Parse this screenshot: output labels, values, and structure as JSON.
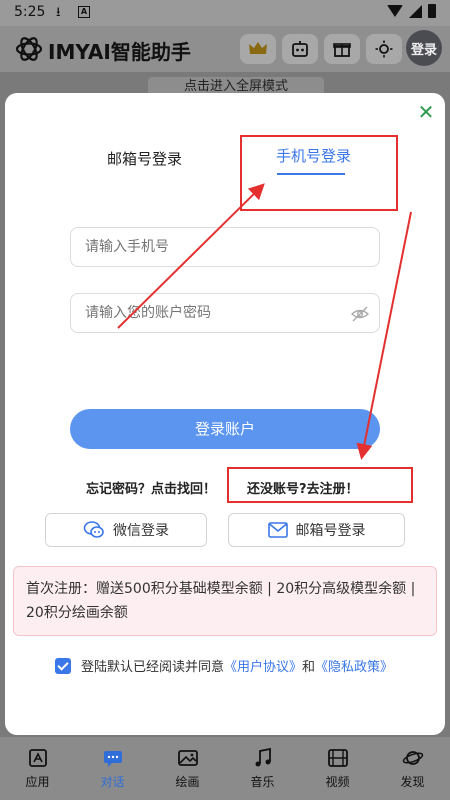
{
  "status_bar": {
    "time": "5:25",
    "download_icon": "download-icon",
    "a_badge": "A"
  },
  "header": {
    "title": "IMYAI智能助手",
    "login_label": "登录",
    "icons": [
      "crown-icon",
      "robot-icon",
      "gift-icon",
      "sun-icon"
    ]
  },
  "fullscreen_tip": "点击进入全屏模式",
  "modal": {
    "tabs": {
      "email": "邮箱号登录",
      "phone": "手机号登录",
      "active": "phone"
    },
    "phone_placeholder": "请输入手机号",
    "password_placeholder": "请输入您的账户密码",
    "login_button": "登录账户",
    "forgot": "忘记密码？点击找回！",
    "register": "还没账号?去注册！",
    "wechat_login": "微信登录",
    "email_login": "邮箱号登录",
    "notice": "首次注册：赠送500积分基础模型余额 | 20积分高级模型余额 | 20积分绘画余额",
    "agree_prefix": "登陆默认已经阅读并同意",
    "user_agreement": "《用户协议》",
    "and": "和",
    "privacy_policy": "《隐私政策》",
    "agree_checked": true
  },
  "bottom_nav": [
    {
      "label": "应用",
      "icon": "apps-icon",
      "active": false
    },
    {
      "label": "对话",
      "icon": "chat-icon",
      "active": true
    },
    {
      "label": "绘画",
      "icon": "image-icon",
      "active": false
    },
    {
      "label": "音乐",
      "icon": "music-icon",
      "active": false
    },
    {
      "label": "视频",
      "icon": "video-icon",
      "active": false
    },
    {
      "label": "发现",
      "icon": "planet-icon",
      "active": false
    }
  ],
  "colors": {
    "accent": "#3a77e8",
    "button": "#5b95ef",
    "annotation": "#e53030",
    "close": "#2e9b4d"
  }
}
